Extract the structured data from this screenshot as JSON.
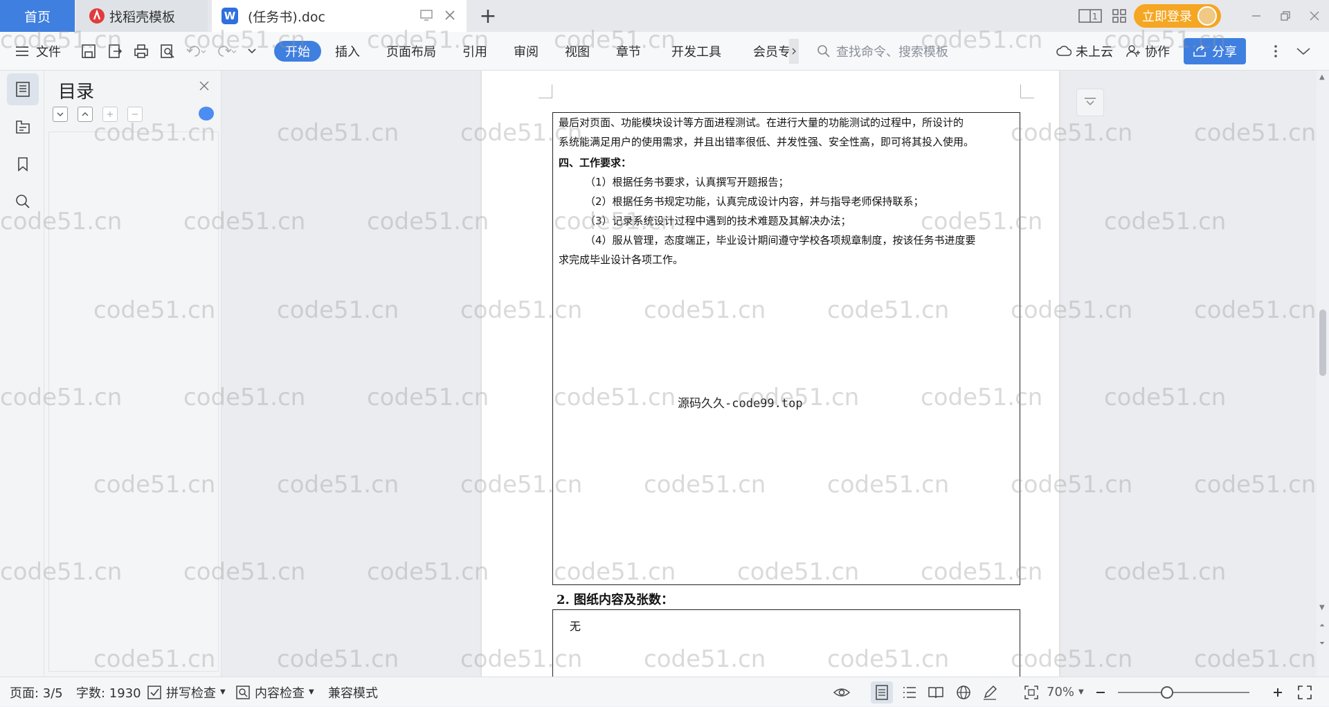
{
  "tabs": {
    "home": "首页",
    "template": "找稻壳模板",
    "document": "(任务书).doc",
    "new_tab": "+"
  },
  "account": {
    "login": "立即登录"
  },
  "menu": {
    "file": "文件",
    "items": [
      "开始",
      "插入",
      "页面布局",
      "引用",
      "审阅",
      "视图",
      "章节",
      "开发工具",
      "会员专"
    ],
    "search_placeholder": "查找命令、搜索模板",
    "cloud": "未上云",
    "collab": "协作",
    "share": "分享"
  },
  "outline": {
    "title": "目录"
  },
  "document": {
    "box1_lines": [
      "最后对页面、功能模块设计等方面进程测试。在进行大量的功能测试的过程中，所设计的",
      "系统能满足用户的使用需求，并且出错率很低、并发性强、安全性高，即可将其投入使用。"
    ],
    "section4_heading": "四、工作要求：",
    "requirements": [
      "（1）根据任务书要求，认真撰写开题报告；",
      "（2）根据任务书规定功能，认真完成设计内容，并与指导老师保持联系；",
      "（3）记录系统设计过程中遇到的技术难题及其解决办法；",
      "（4）服从管理，态度端正，毕业设计期间遵守学校各项规章制度，按该任务书进度要"
    ],
    "requirement4_cont": "求完成毕业设计各项工作。",
    "inline_mark": "源码久久-code99.top",
    "section2_heading": "2.  图纸内容及张数：",
    "section2_value": "无"
  },
  "status": {
    "page": "页面: 3/5",
    "words": "字数: 1930",
    "spell": "拼写检查",
    "content_check": "内容检查",
    "compat": "兼容模式",
    "zoom": "70%"
  },
  "watermark": {
    "text": "code51.cn"
  },
  "colors": {
    "accent": "#3f7fe0",
    "login": "#f5a623"
  }
}
